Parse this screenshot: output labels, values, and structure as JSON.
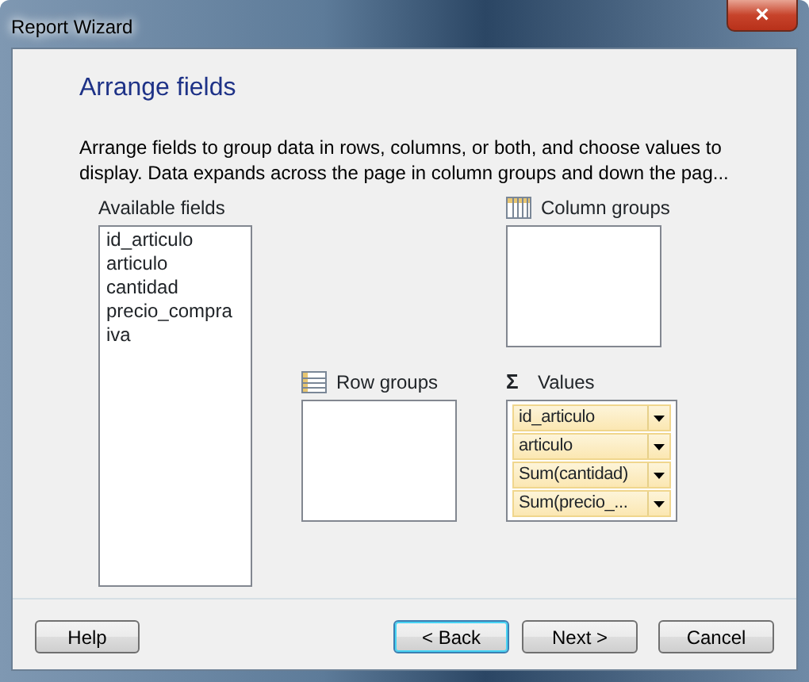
{
  "window": {
    "title": "Report Wizard",
    "close": "×"
  },
  "heading": "Arrange fields",
  "description": "Arrange fields to group data in rows, columns, or both, and choose values to display. Data expands across the page in column groups and down the pag...",
  "available_fields": {
    "label": "Available fields",
    "items": [
      "id_articulo",
      "articulo",
      "cantidad",
      "precio_compra",
      "iva"
    ]
  },
  "column_groups": {
    "label": "Column groups"
  },
  "row_groups": {
    "label": "Row groups"
  },
  "values": {
    "label": "Values",
    "icon": "Σ",
    "items": [
      "id_articulo",
      "articulo",
      "Sum(cantidad)",
      "Sum(precio_..."
    ]
  },
  "buttons": [
    {
      "label": "Help",
      "default": false
    },
    {
      "label": "< Back",
      "default": true
    },
    {
      "label": "Next >",
      "default": false
    },
    {
      "label": "Cancel",
      "default": false
    }
  ]
}
